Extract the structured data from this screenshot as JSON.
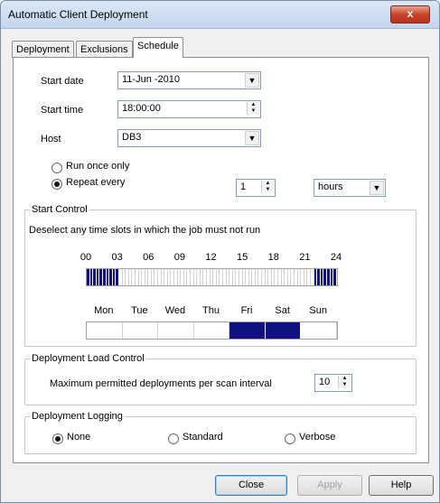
{
  "window": {
    "title": "Automatic Client Deployment",
    "close_glyph": "x"
  },
  "tabs": [
    {
      "label": "Deployment",
      "active": false
    },
    {
      "label": "Exclusions",
      "active": false
    },
    {
      "label": "Schedule",
      "active": true
    }
  ],
  "start_date": {
    "label": "Start date",
    "value": "11-Jun -2010"
  },
  "start_time": {
    "label": "Start time",
    "value": "18:00:00"
  },
  "host": {
    "label": "Host",
    "value": "DB3"
  },
  "run_once": {
    "label": "Run once only",
    "selected": false
  },
  "repeat": {
    "label": "Repeat every",
    "selected": true,
    "count": "1",
    "unit": "hours"
  },
  "start_control": {
    "title": "Start Control",
    "instruction": "Deselect any time slots in which the job must not run",
    "hour_labels": [
      "00",
      "03",
      "06",
      "09",
      "12",
      "15",
      "18",
      "21",
      "24"
    ],
    "hour_slots": [
      1,
      1,
      1,
      1,
      1,
      1,
      1,
      1,
      1,
      1,
      0,
      0,
      0,
      0,
      0,
      0,
      0,
      0,
      0,
      0,
      0,
      0,
      0,
      0,
      0,
      0,
      0,
      0,
      0,
      0,
      0,
      0,
      0,
      0,
      0,
      0,
      0,
      0,
      0,
      0,
      0,
      0,
      0,
      0,
      0,
      0,
      0,
      0,
      0,
      0,
      0,
      0,
      0,
      0,
      0,
      0,
      0,
      0,
      0,
      0,
      0,
      0,
      0,
      0,
      0,
      0,
      0,
      0,
      0,
      0,
      1,
      1,
      1,
      1,
      1,
      1,
      1
    ],
    "day_labels": [
      "Mon",
      "Tue",
      "Wed",
      "Thu",
      "Fri",
      "Sat",
      "Sun"
    ],
    "day_slots": [
      0,
      0,
      0,
      0,
      1,
      1,
      0
    ]
  },
  "load_control": {
    "title": "Deployment Load Control",
    "label": "Maximum permitted deployments per scan interval",
    "value": "10"
  },
  "logging": {
    "title": "Deployment Logging",
    "options": [
      {
        "label": "None",
        "selected": true
      },
      {
        "label": "Standard",
        "selected": false
      },
      {
        "label": "Verbose",
        "selected": false
      }
    ]
  },
  "buttons": {
    "close": "Close",
    "apply": "Apply",
    "help": "Help"
  },
  "colors": {
    "selected_slot": "#101080",
    "accent_close": "#c8432b"
  }
}
